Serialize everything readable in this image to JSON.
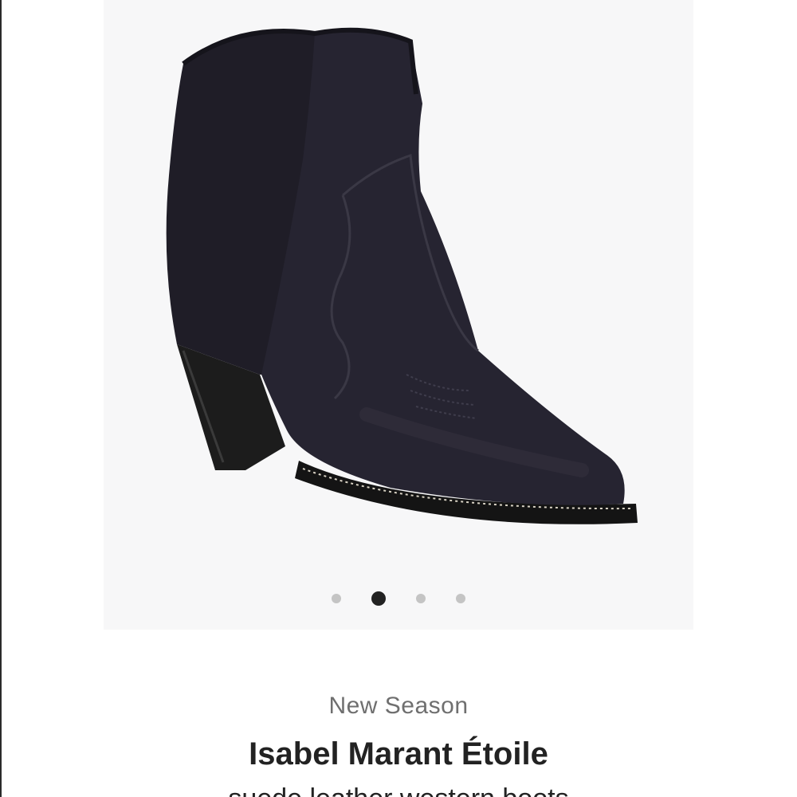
{
  "product": {
    "season_label": "New Season",
    "brand": "Isabel Marant Étoile",
    "description": "suede leather western boots"
  },
  "gallery": {
    "image_count": 4,
    "active_index": 1
  },
  "colors": {
    "boot": "#23212b",
    "heel": "#1c1c1c",
    "lining": "#a0714b",
    "background": "#f7f7f8",
    "dot_inactive": "#c4c4c4",
    "dot_active": "#222222"
  }
}
